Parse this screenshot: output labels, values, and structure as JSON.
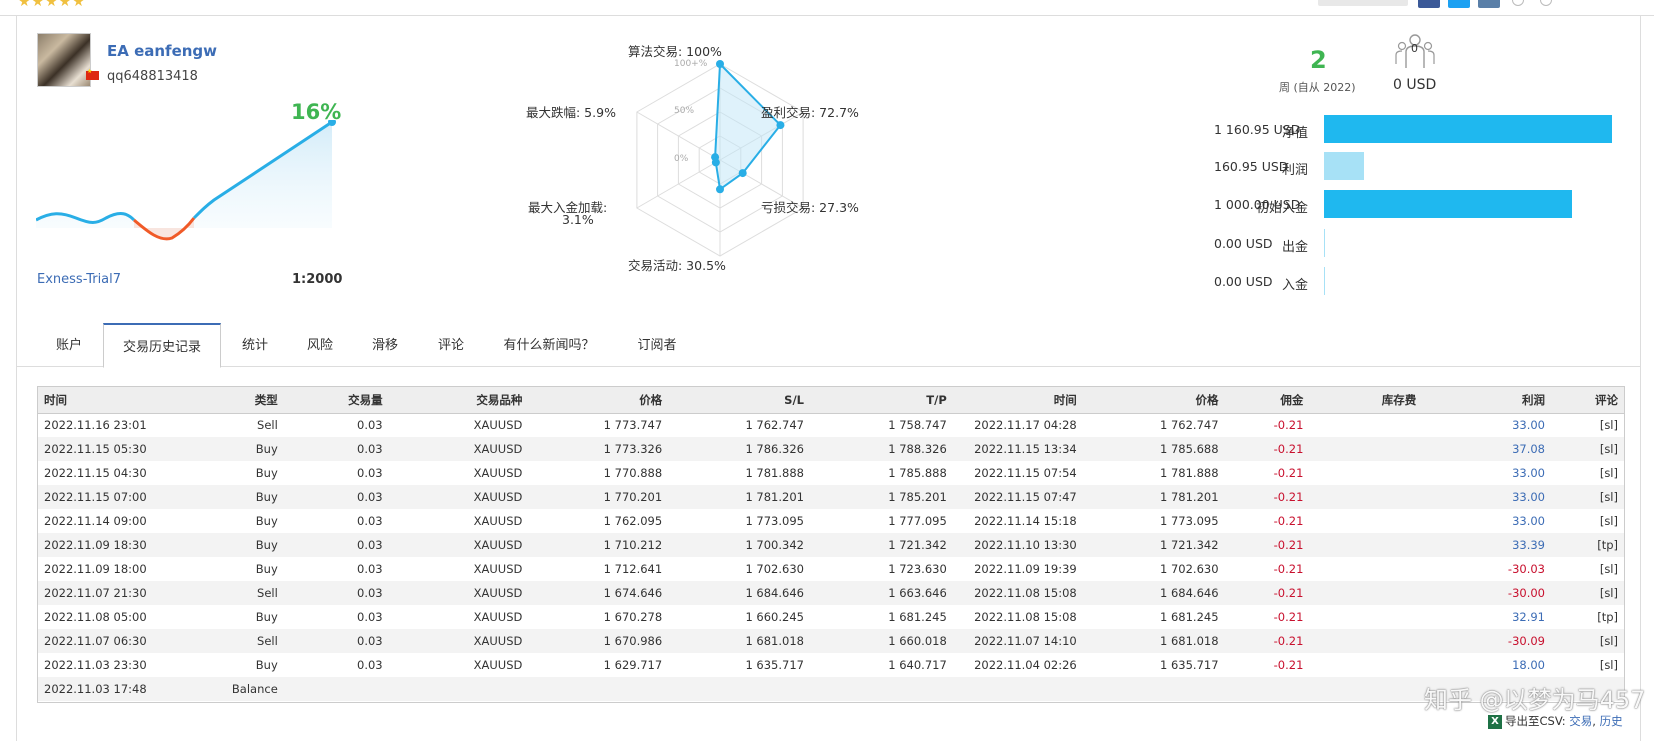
{
  "top": {
    "stars": "★★★★★"
  },
  "profile": {
    "name": "EA eanfengw",
    "login": "qq648813418",
    "growth": "16%",
    "broker": "Exness-Trial7",
    "leverage": "1:2000"
  },
  "radar": {
    "algo": "算法交易: 100%",
    "profit_trades": "盈利交易: 72.7%",
    "loss_trades": "亏损交易: 27.3%",
    "activity": "交易活动: 30.5%",
    "max_deposit_load_1": "最大入金加载:",
    "max_deposit_load_2": "3.1%",
    "max_drawdown": "最大跌幅: 5.9%",
    "ring_100": "100+%",
    "ring_50": "50%",
    "ring_0": "0%",
    "values": [
      1.0,
      0.727,
      0.273,
      0.305,
      0.031,
      0.059
    ]
  },
  "summary": {
    "weeks": "2",
    "weeks_label": "周 (自从 2022)",
    "subscribers": "0",
    "subscription_amount": "0 USD",
    "rows": [
      {
        "label": "净值",
        "value": "1 160.95 USD",
        "fraction": 1.0,
        "color": "#1fb8ef"
      },
      {
        "label": "利润",
        "value": "160.95 USD",
        "fraction": 0.139,
        "color": "#a7e1f6"
      },
      {
        "label": "初始入金",
        "value": "1 000.00 USD",
        "fraction": 0.861,
        "color": "#1fb8ef"
      },
      {
        "label": "出金",
        "value": "0.00 USD",
        "fraction": 0,
        "color": "#a7e1f6"
      },
      {
        "label": "入金",
        "value": "0.00 USD",
        "fraction": 0,
        "color": "#a7e1f6"
      }
    ]
  },
  "tabs": [
    "账户",
    "交易历史记录",
    "统计",
    "风险",
    "滑移",
    "评论",
    "有什么新闻吗？",
    "订阅者"
  ],
  "table": {
    "headers": [
      "时间",
      "类型",
      "交易量",
      "交易品种",
      "价格",
      "S/L",
      "T/P",
      "时间",
      "价格",
      "佣金",
      "库存费",
      "利润",
      "评论"
    ],
    "rows": [
      [
        "2022.11.16 23:01",
        "Sell",
        "0.03",
        "XAUUSD",
        "1 773.747",
        "1 762.747",
        "1 758.747",
        "2022.11.17 04:28",
        "1 762.747",
        "-0.21",
        "",
        "33.00",
        "[sl]"
      ],
      [
        "2022.11.15 05:30",
        "Buy",
        "0.03",
        "XAUUSD",
        "1 773.326",
        "1 786.326",
        "1 788.326",
        "2022.11.15 13:34",
        "1 785.688",
        "-0.21",
        "",
        "37.08",
        "[sl]"
      ],
      [
        "2022.11.15 04:30",
        "Buy",
        "0.03",
        "XAUUSD",
        "1 770.888",
        "1 781.888",
        "1 785.888",
        "2022.11.15 07:54",
        "1 781.888",
        "-0.21",
        "",
        "33.00",
        "[sl]"
      ],
      [
        "2022.11.15 07:00",
        "Buy",
        "0.03",
        "XAUUSD",
        "1 770.201",
        "1 781.201",
        "1 785.201",
        "2022.11.15 07:47",
        "1 781.201",
        "-0.21",
        "",
        "33.00",
        "[sl]"
      ],
      [
        "2022.11.14 09:00",
        "Buy",
        "0.03",
        "XAUUSD",
        "1 762.095",
        "1 773.095",
        "1 777.095",
        "2022.11.14 15:18",
        "1 773.095",
        "-0.21",
        "",
        "33.00",
        "[sl]"
      ],
      [
        "2022.11.09 18:30",
        "Buy",
        "0.03",
        "XAUUSD",
        "1 710.212",
        "1 700.342",
        "1 721.342",
        "2022.11.10 13:30",
        "1 721.342",
        "-0.21",
        "",
        "33.39",
        "[tp]"
      ],
      [
        "2022.11.09 18:00",
        "Buy",
        "0.03",
        "XAUUSD",
        "1 712.641",
        "1 702.630",
        "1 723.630",
        "2022.11.09 19:39",
        "1 702.630",
        "-0.21",
        "",
        "-30.03",
        "[sl]"
      ],
      [
        "2022.11.07 21:30",
        "Sell",
        "0.03",
        "XAUUSD",
        "1 674.646",
        "1 684.646",
        "1 663.646",
        "2022.11.08 15:08",
        "1 684.646",
        "-0.21",
        "",
        "-30.00",
        "[sl]"
      ],
      [
        "2022.11.08 05:00",
        "Buy",
        "0.03",
        "XAUUSD",
        "1 670.278",
        "1 660.245",
        "1 681.245",
        "2022.11.08 15:08",
        "1 681.245",
        "-0.21",
        "",
        "32.91",
        "[tp]"
      ],
      [
        "2022.11.07 06:30",
        "Sell",
        "0.03",
        "XAUUSD",
        "1 670.986",
        "1 681.018",
        "1 660.018",
        "2022.11.07 14:10",
        "1 681.018",
        "-0.21",
        "",
        "-30.09",
        "[sl]"
      ],
      [
        "2022.11.03 23:30",
        "Buy",
        "0.03",
        "XAUUSD",
        "1 629.717",
        "1 635.717",
        "1 640.717",
        "2022.11.04 02:26",
        "1 635.717",
        "-0.21",
        "",
        "18.00",
        "[sl]"
      ],
      [
        "2022.11.03 17:48",
        "Balance",
        "",
        "",
        "",
        "",
        "",
        "",
        "",
        "",
        "",
        "",
        ""
      ]
    ]
  },
  "watermark": "知乎 @以梦为马457",
  "export": {
    "icon": "X",
    "label": "导出至CSV:",
    "trades": "交易",
    "sep": ",",
    "history": "历史"
  },
  "colors": {
    "link": "#3c6cb5",
    "green": "#3fb552",
    "negative": "#c8102e",
    "bar": "#1fb8ef",
    "bar_light": "#a7e1f6"
  }
}
